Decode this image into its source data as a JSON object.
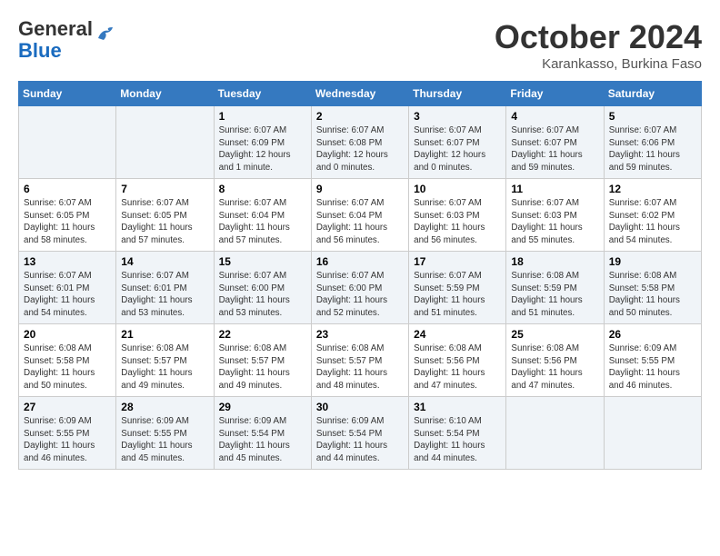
{
  "header": {
    "logo_general": "General",
    "logo_blue": "Blue",
    "month_title": "October 2024",
    "subtitle": "Karankasso, Burkina Faso"
  },
  "days_of_week": [
    "Sunday",
    "Monday",
    "Tuesday",
    "Wednesday",
    "Thursday",
    "Friday",
    "Saturday"
  ],
  "weeks": [
    [
      {
        "day": "",
        "info": ""
      },
      {
        "day": "",
        "info": ""
      },
      {
        "day": "1",
        "info": "Sunrise: 6:07 AM\nSunset: 6:09 PM\nDaylight: 12 hours\nand 1 minute."
      },
      {
        "day": "2",
        "info": "Sunrise: 6:07 AM\nSunset: 6:08 PM\nDaylight: 12 hours\nand 0 minutes."
      },
      {
        "day": "3",
        "info": "Sunrise: 6:07 AM\nSunset: 6:07 PM\nDaylight: 12 hours\nand 0 minutes."
      },
      {
        "day": "4",
        "info": "Sunrise: 6:07 AM\nSunset: 6:07 PM\nDaylight: 11 hours\nand 59 minutes."
      },
      {
        "day": "5",
        "info": "Sunrise: 6:07 AM\nSunset: 6:06 PM\nDaylight: 11 hours\nand 59 minutes."
      }
    ],
    [
      {
        "day": "6",
        "info": "Sunrise: 6:07 AM\nSunset: 6:05 PM\nDaylight: 11 hours\nand 58 minutes."
      },
      {
        "day": "7",
        "info": "Sunrise: 6:07 AM\nSunset: 6:05 PM\nDaylight: 11 hours\nand 57 minutes."
      },
      {
        "day": "8",
        "info": "Sunrise: 6:07 AM\nSunset: 6:04 PM\nDaylight: 11 hours\nand 57 minutes."
      },
      {
        "day": "9",
        "info": "Sunrise: 6:07 AM\nSunset: 6:04 PM\nDaylight: 11 hours\nand 56 minutes."
      },
      {
        "day": "10",
        "info": "Sunrise: 6:07 AM\nSunset: 6:03 PM\nDaylight: 11 hours\nand 56 minutes."
      },
      {
        "day": "11",
        "info": "Sunrise: 6:07 AM\nSunset: 6:03 PM\nDaylight: 11 hours\nand 55 minutes."
      },
      {
        "day": "12",
        "info": "Sunrise: 6:07 AM\nSunset: 6:02 PM\nDaylight: 11 hours\nand 54 minutes."
      }
    ],
    [
      {
        "day": "13",
        "info": "Sunrise: 6:07 AM\nSunset: 6:01 PM\nDaylight: 11 hours\nand 54 minutes."
      },
      {
        "day": "14",
        "info": "Sunrise: 6:07 AM\nSunset: 6:01 PM\nDaylight: 11 hours\nand 53 minutes."
      },
      {
        "day": "15",
        "info": "Sunrise: 6:07 AM\nSunset: 6:00 PM\nDaylight: 11 hours\nand 53 minutes."
      },
      {
        "day": "16",
        "info": "Sunrise: 6:07 AM\nSunset: 6:00 PM\nDaylight: 11 hours\nand 52 minutes."
      },
      {
        "day": "17",
        "info": "Sunrise: 6:07 AM\nSunset: 5:59 PM\nDaylight: 11 hours\nand 51 minutes."
      },
      {
        "day": "18",
        "info": "Sunrise: 6:08 AM\nSunset: 5:59 PM\nDaylight: 11 hours\nand 51 minutes."
      },
      {
        "day": "19",
        "info": "Sunrise: 6:08 AM\nSunset: 5:58 PM\nDaylight: 11 hours\nand 50 minutes."
      }
    ],
    [
      {
        "day": "20",
        "info": "Sunrise: 6:08 AM\nSunset: 5:58 PM\nDaylight: 11 hours\nand 50 minutes."
      },
      {
        "day": "21",
        "info": "Sunrise: 6:08 AM\nSunset: 5:57 PM\nDaylight: 11 hours\nand 49 minutes."
      },
      {
        "day": "22",
        "info": "Sunrise: 6:08 AM\nSunset: 5:57 PM\nDaylight: 11 hours\nand 49 minutes."
      },
      {
        "day": "23",
        "info": "Sunrise: 6:08 AM\nSunset: 5:57 PM\nDaylight: 11 hours\nand 48 minutes."
      },
      {
        "day": "24",
        "info": "Sunrise: 6:08 AM\nSunset: 5:56 PM\nDaylight: 11 hours\nand 47 minutes."
      },
      {
        "day": "25",
        "info": "Sunrise: 6:08 AM\nSunset: 5:56 PM\nDaylight: 11 hours\nand 47 minutes."
      },
      {
        "day": "26",
        "info": "Sunrise: 6:09 AM\nSunset: 5:55 PM\nDaylight: 11 hours\nand 46 minutes."
      }
    ],
    [
      {
        "day": "27",
        "info": "Sunrise: 6:09 AM\nSunset: 5:55 PM\nDaylight: 11 hours\nand 46 minutes."
      },
      {
        "day": "28",
        "info": "Sunrise: 6:09 AM\nSunset: 5:55 PM\nDaylight: 11 hours\nand 45 minutes."
      },
      {
        "day": "29",
        "info": "Sunrise: 6:09 AM\nSunset: 5:54 PM\nDaylight: 11 hours\nand 45 minutes."
      },
      {
        "day": "30",
        "info": "Sunrise: 6:09 AM\nSunset: 5:54 PM\nDaylight: 11 hours\nand 44 minutes."
      },
      {
        "day": "31",
        "info": "Sunrise: 6:10 AM\nSunset: 5:54 PM\nDaylight: 11 hours\nand 44 minutes."
      },
      {
        "day": "",
        "info": ""
      },
      {
        "day": "",
        "info": ""
      }
    ]
  ]
}
